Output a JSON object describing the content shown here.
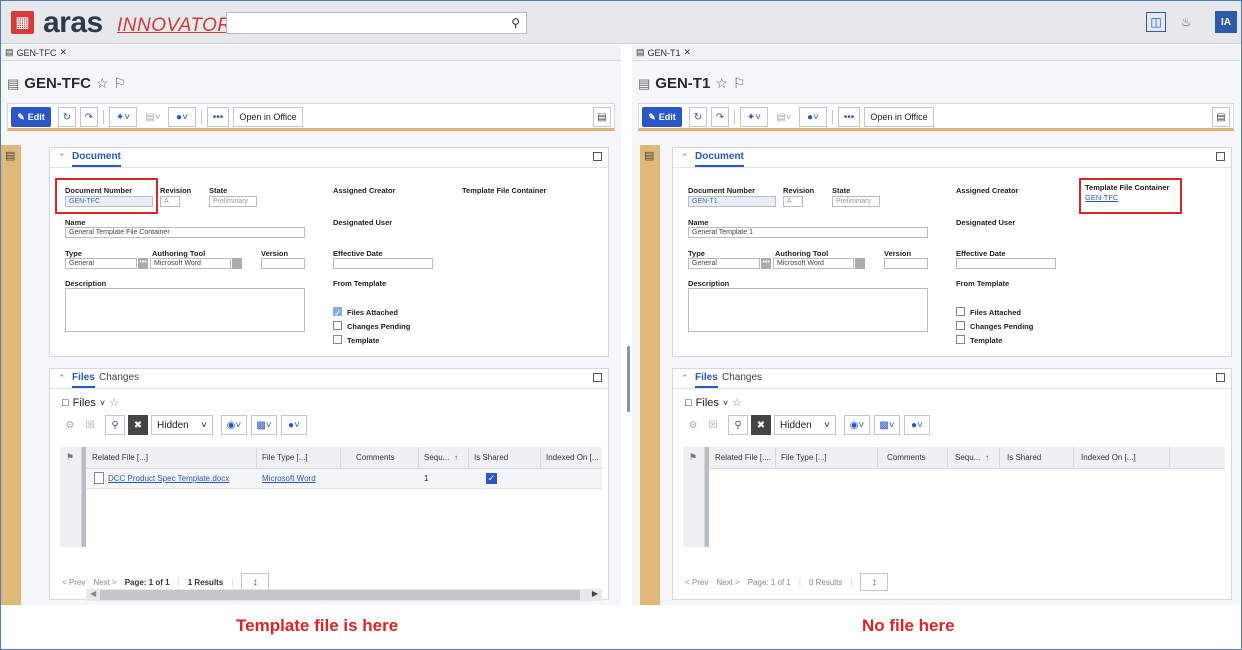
{
  "app": {
    "logo_main": "aras",
    "logo_sub": "INNOVATOR",
    "user_initials": "IA",
    "search_placeholder": ""
  },
  "toolbar": {
    "edit_label": "Edit",
    "open_in_office": "Open in Office"
  },
  "fields": {
    "document_number": "Document Number",
    "revision": "Revision",
    "state": "State",
    "assigned_creator": "Assigned Creator",
    "template_file_container": "Template File Container",
    "name": "Name",
    "designated_user": "Designated User",
    "type": "Type",
    "authoring_tool": "Authoring Tool",
    "version": "Version",
    "effective_date": "Effective Date",
    "description": "Description",
    "from_template": "From Template",
    "files_attached": "Files Attached",
    "changes_pending": "Changes Pending",
    "template": "Template"
  },
  "relationships": {
    "files_tab": "Files",
    "changes_tab": "Changes",
    "files_label": "Files",
    "hidden_select": "Hidden",
    "columns": [
      "Related File [...]",
      "File Type [...]",
      "Comments",
      "Sequ...",
      "Is Shared",
      "Indexed On [..."
    ],
    "columns_right": [
      "Related File [....",
      "File Type [...]",
      "Comments",
      "Sequ...",
      "Is Shared",
      "Indexed On [...]"
    ],
    "prev": "Prev",
    "next": "Next",
    "page": "Page: 1 of 1"
  },
  "left": {
    "tab": "GEN-TFC",
    "title": "GEN-TFC",
    "section": "Document",
    "document_number": "GEN-TFC",
    "revision": "A",
    "state": "Preliminary",
    "name": "General Template File Container",
    "type": "General",
    "authoring_tool": "Microsoft Word",
    "template_file_container": "",
    "files_attached": true,
    "changes_pending": false,
    "template": false,
    "rows": [
      {
        "related_file": "DCC Product Spec Template.docx",
        "file_type": "Microsoft Word",
        "comments": "",
        "sequence": "1",
        "is_shared": true,
        "indexed_on": ""
      }
    ],
    "results": "1 Results",
    "caption": "Template file is here"
  },
  "right": {
    "tab": "GEN-T1",
    "title": "GEN-T1",
    "section": "Document",
    "document_number": "GEN-T1",
    "revision": "A",
    "state": "Preliminary",
    "name": "General Template 1",
    "type": "General",
    "authoring_tool": "Microsoft Word",
    "template_file_container": "GEN-TFC",
    "files_attached": false,
    "changes_pending": false,
    "template": false,
    "rows": [],
    "results": "0 Results",
    "caption": "No file here"
  },
  "colors": {
    "accent": "#2a56c6",
    "highlight": "#d62828",
    "caption": "#e02424",
    "sidebar": "#dfb97a"
  }
}
